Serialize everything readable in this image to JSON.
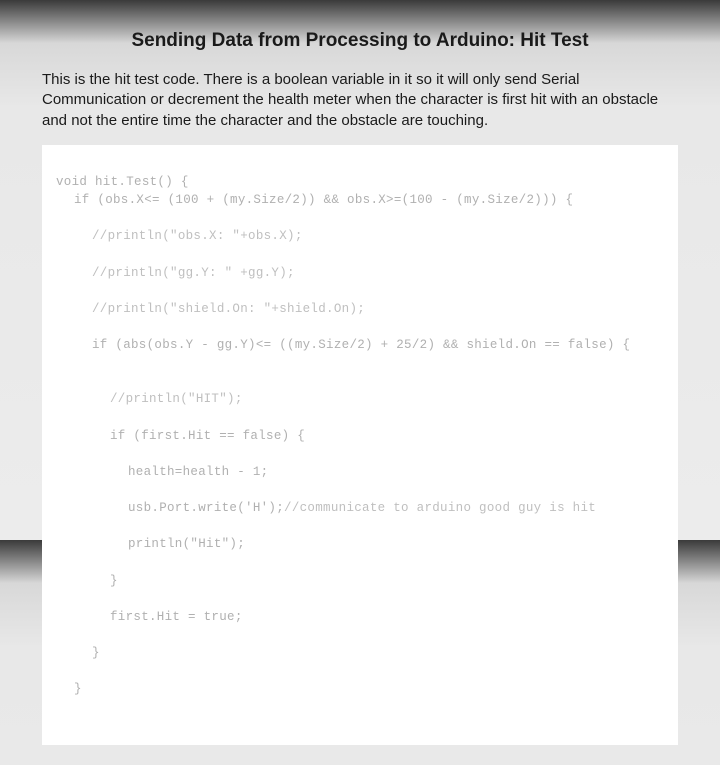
{
  "title": "Sending Data from Processing to Arduino: Hit Test",
  "body": "This is the hit test code. There is a boolean variable in it so it will only send Serial Communication or decrement the health meter when the character is first hit with an obstacle and not the entire time the character and the obstacle are touching.",
  "code": {
    "l1": "void hit.Test() {",
    "l2": "if (obs.X<= (100 + (my.Size/2)) && obs.X>=(100 - (my.Size/2))) {",
    "l3": "//println(\"obs.X: \"+obs.X);",
    "l4": "//println(\"gg.Y: \" +gg.Y);",
    "l5": "//println(\"shield.On: \"+shield.On);",
    "l6": "if (abs(obs.Y - gg.Y)<= ((my.Size/2) + 25/2) && shield.On == false) {",
    "l7": "",
    "l8": "//println(\"HIT\");",
    "l9": "if (first.Hit == false) {",
    "l10": "health=health - 1;",
    "l11a": "usb.Port.write('H');",
    "l11b": "//communicate to arduino good guy is hit",
    "l12": "println(\"Hit\");",
    "l13": "}",
    "l14": "first.Hit = true;",
    "l15": "}",
    "l16": "}"
  }
}
